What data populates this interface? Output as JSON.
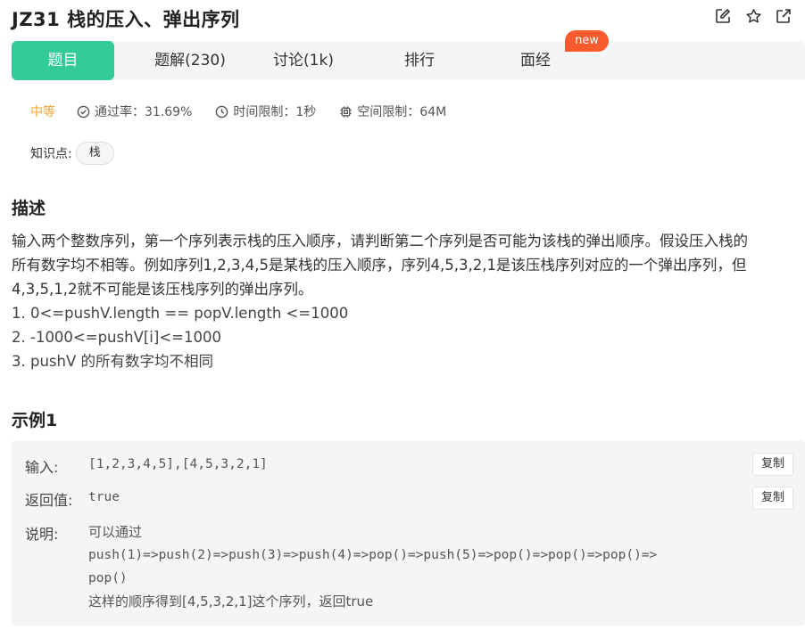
{
  "header": {
    "title": "JZ31  栈的压入、弹出序列",
    "icons": [
      "edit-icon",
      "star-icon",
      "external-link-icon"
    ]
  },
  "tabs": [
    {
      "label": "题目",
      "active": true
    },
    {
      "label": "题解(230)",
      "active": false
    },
    {
      "label": "讨论(1k)",
      "active": false
    },
    {
      "label": "排行",
      "active": false
    },
    {
      "label": "面经",
      "active": false
    }
  ],
  "badge": "new",
  "meta": {
    "difficulty": "中等",
    "pass_rate": "通过率：31.69%",
    "time_limit": "时间限制：1秒",
    "space_limit": "空间限制：64M"
  },
  "knowledge": {
    "label": "知识点:",
    "tags": [
      "栈"
    ]
  },
  "description": {
    "title": "描述",
    "lines": [
      "输入两个整数序列，第一个序列表示栈的压入顺序，请判断第二个序列是否可能为该栈的弹出顺序。假设压入栈的",
      "所有数字均不相等。例如序列1,2,3,4,5是某栈的压入顺序，序列4,5,3,2,1是该压栈序列对应的一个弹出序列，但",
      "4,3,5,1,2就不可能是该压栈序列的弹出序列。",
      "1. 0<=pushV.length == popV.length <=1000",
      "2. -1000<=pushV[i]<=1000",
      "3. pushV 的所有数字均不相同"
    ]
  },
  "example": {
    "title": "示例1",
    "input_label": "输入:",
    "input_value": "[1,2,3,4,5],[4,5,3,2,1]",
    "output_label": "返回值:",
    "output_value": "true",
    "copy_label": "复制",
    "explain_label": "说明:",
    "explain_lines": [
      "可以通过",
      "push(1)=>push(2)=>push(3)=>push(4)=>pop()=>push(5)=>pop()=>pop()=>pop()=>",
      "pop()",
      "这样的顺序得到[4,5,3,2,1]这个序列，返回true"
    ]
  },
  "colors": {
    "accent": "#32ca99",
    "badge": "#fa5b2d",
    "difficulty": "#f0a32c"
  }
}
